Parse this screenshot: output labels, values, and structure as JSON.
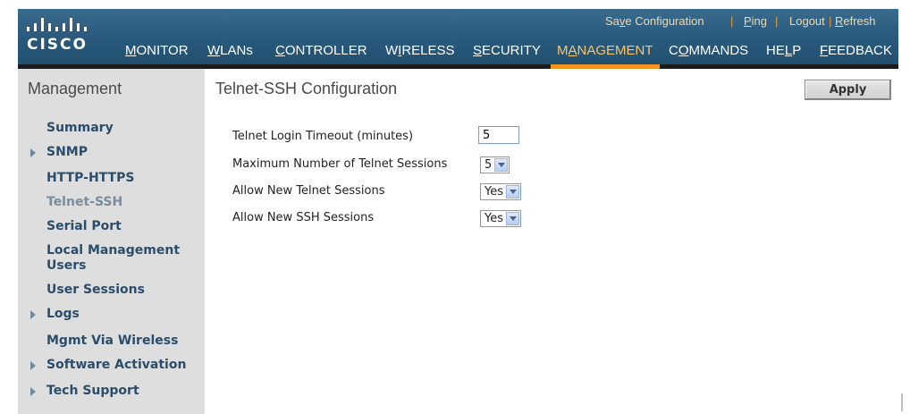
{
  "brand": {
    "logo_text": "CISCO"
  },
  "utility_links": [
    {
      "prefix": "Sa",
      "u": "v",
      "suffix": "e Configuration"
    },
    {
      "prefix": "",
      "u": "P",
      "suffix": "ing"
    },
    {
      "prefix": "Lo",
      "u": "g",
      "suffix": "out"
    },
    {
      "prefix": "",
      "u": "R",
      "suffix": "efresh"
    }
  ],
  "nav": [
    {
      "u": "M",
      "rest": "ONITOR"
    },
    {
      "u": "W",
      "rest": "LANs"
    },
    {
      "u": "C",
      "rest": "ONTROLLER"
    },
    {
      "u": "W",
      "pre": "",
      "rest": "IRELESS",
      "display": "WIRELESS"
    },
    {
      "u": "S",
      "rest": "ECURITY"
    },
    {
      "u": "A",
      "pre": "M",
      "rest": "NAGEMENT"
    },
    {
      "u": "O",
      "pre": "C",
      "rest": "MMANDS"
    },
    {
      "u": "L",
      "pre": "HE",
      "rest": "P"
    },
    {
      "u": "F",
      "rest": "EEDBACK"
    }
  ],
  "sidebar": {
    "title": "Management",
    "items": [
      {
        "label": "Summary"
      },
      {
        "label": "SNMP"
      },
      {
        "label": "HTTP-HTTPS"
      },
      {
        "label": "Telnet-SSH"
      },
      {
        "label": "Serial Port"
      },
      {
        "label": "Local Management Users"
      },
      {
        "label": "User Sessions"
      },
      {
        "label": "Logs"
      },
      {
        "label": "Mgmt Via Wireless"
      },
      {
        "label": "Software Activation"
      },
      {
        "label": "Tech Support"
      }
    ]
  },
  "main": {
    "title": "Telnet-SSH Configuration",
    "apply_label": "Apply",
    "fields": {
      "timeout_label": "Telnet Login Timeout (minutes)",
      "timeout_value": "5",
      "max_sessions_label": "Maximum Number of Telnet Sessions",
      "max_sessions_value": "5",
      "allow_telnet_label": "Allow New Telnet Sessions",
      "allow_telnet_value": "Yes",
      "allow_ssh_label": "Allow New SSH Sessions",
      "allow_ssh_value": "Yes"
    }
  },
  "colors": {
    "header": "#2b5b7f",
    "accent": "#f7941d",
    "sidebar_bg": "#dedede",
    "link": "#2a4d6b"
  }
}
